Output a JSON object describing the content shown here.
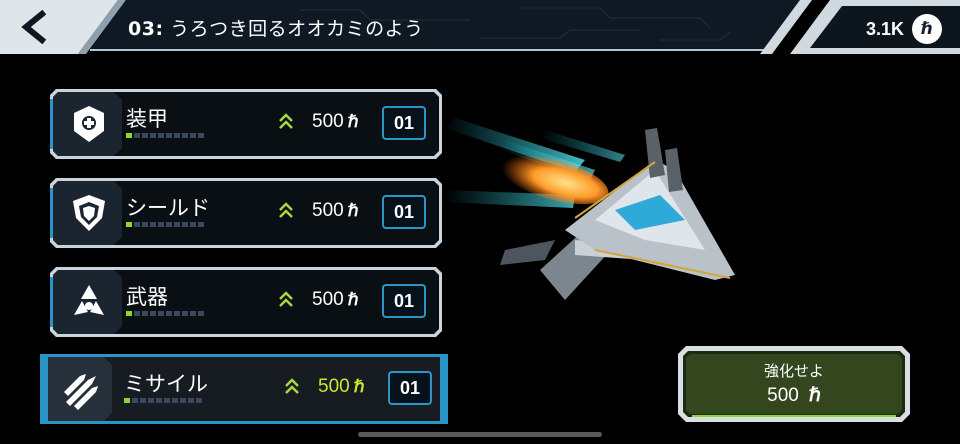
{
  "header": {
    "level_number": "03:",
    "level_name": "うろつき回るオオカミのよう",
    "currency_amount": "3.1K",
    "currency_symbol": "ℏ"
  },
  "upgrades": [
    {
      "name": "装甲",
      "icon": "armor-icon",
      "price": "500",
      "level": "01",
      "progress": 1,
      "progress_max": 10
    },
    {
      "name": "シールド",
      "icon": "shield-icon",
      "price": "500",
      "level": "01",
      "progress": 1,
      "progress_max": 10
    },
    {
      "name": "武器",
      "icon": "weapon-icon",
      "price": "500",
      "level": "01",
      "progress": 1,
      "progress_max": 10
    },
    {
      "name": "ミサイル",
      "icon": "missile-icon",
      "price": "500",
      "level": "01",
      "progress": 1,
      "progress_max": 10
    }
  ],
  "price_symbol": "ℏ",
  "upgrade_button": {
    "label": "強化せよ",
    "price": "500",
    "symbol": "ℏ"
  },
  "colors": {
    "frame": "#c9d4dc",
    "accent_blue": "#2b95c8",
    "accent_green": "#8fd630",
    "price_highlight": "#c9e830"
  }
}
